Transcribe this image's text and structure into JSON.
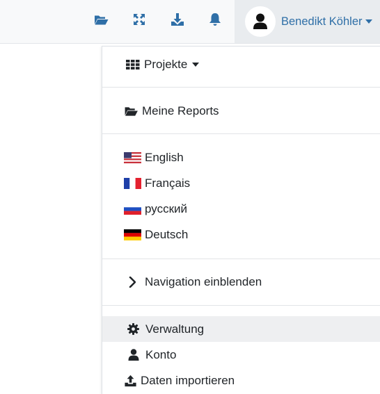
{
  "navbar": {
    "icons": [
      "folder-open-icon",
      "expand-icon",
      "download-icon",
      "bell-icon"
    ],
    "user": {
      "name": "Benedikt Köhler",
      "avatar_icon": "user-icon"
    },
    "accent_color": "#2f6fa7"
  },
  "menu": {
    "projects_label": "Projekte",
    "reports_label": "Meine Reports",
    "languages": [
      {
        "label": "English",
        "flag": "us-flag"
      },
      {
        "label": "Français",
        "flag": "fr-flag"
      },
      {
        "label": "русский",
        "flag": "ru-flag"
      },
      {
        "label": "Deutsch",
        "flag": "de-flag"
      }
    ],
    "navigation_label": "Navigation einblenden",
    "admin_label": "Verwaltung",
    "account_label": "Konto",
    "import_label": "Daten importieren"
  }
}
